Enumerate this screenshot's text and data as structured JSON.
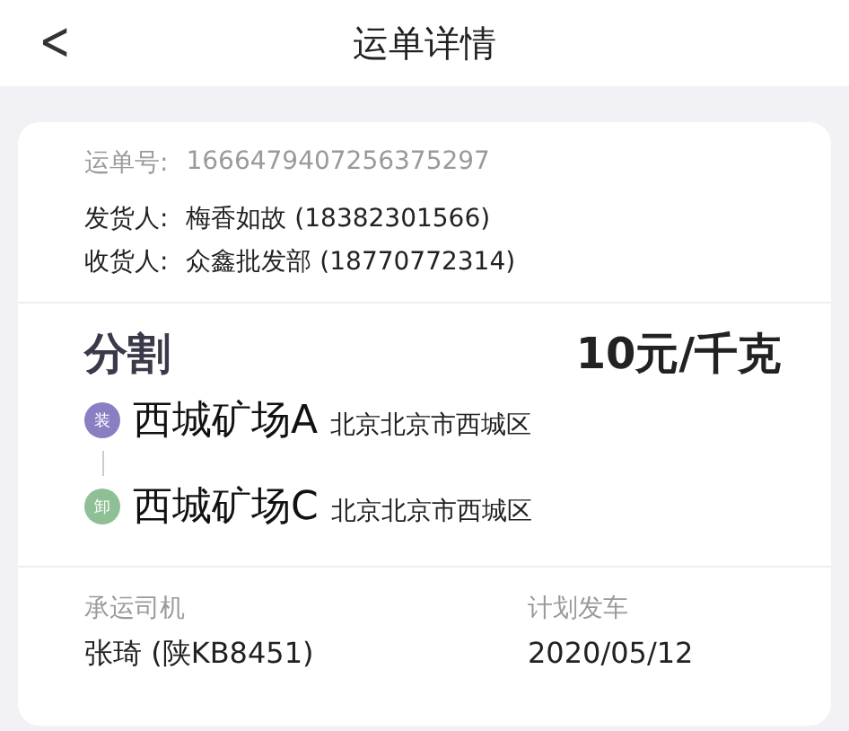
{
  "header": {
    "back": "<",
    "title": "运单详情"
  },
  "order": {
    "number_label": "运单号:",
    "number": "1666479407256375297",
    "parties": [
      {
        "label": "发货人:",
        "value": "梅香如故 (18382301566)"
      },
      {
        "label": "收货人:",
        "value": "众鑫批发部 (18770772314)"
      }
    ]
  },
  "cargo": {
    "name": "分割",
    "price": "10元/千克",
    "stops": [
      {
        "badge": "装",
        "color": "#8b7fc4",
        "place": "西城矿场A",
        "address": "北京北京市西城区"
      },
      {
        "badge": "卸",
        "color": "#8fbf95",
        "place": "西城矿场C",
        "address": "北京北京市西城区"
      }
    ]
  },
  "footer": [
    {
      "label": "承运司机",
      "value": "张琦 (陕KB8451)"
    },
    {
      "label": "计划发车",
      "value": "2020/05/12"
    }
  ]
}
